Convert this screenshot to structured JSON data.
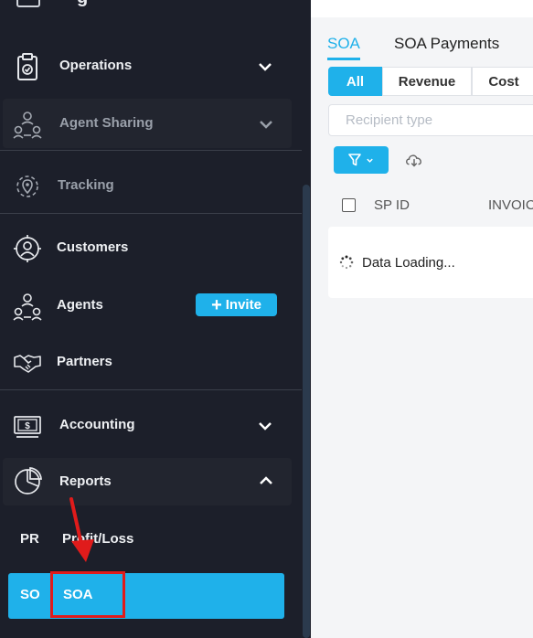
{
  "sidebar": {
    "top_partial_label": "g",
    "items": [
      {
        "key": "operations",
        "label": "Operations",
        "icon": "clipboard-icon",
        "chevron": "down"
      },
      {
        "key": "agent-sharing",
        "label": "Agent Sharing",
        "icon": "agent-sharing-icon",
        "chevron": "down"
      },
      {
        "key": "tracking",
        "label": "Tracking",
        "icon": "location-pin-icon"
      },
      {
        "key": "customers",
        "label": "Customers",
        "icon": "customers-icon"
      },
      {
        "key": "agents",
        "label": "Agents",
        "icon": "agents-icon"
      },
      {
        "key": "partners",
        "label": "Partners",
        "icon": "handshake-icon"
      },
      {
        "key": "accounting",
        "label": "Accounting",
        "icon": "money-icon",
        "chevron": "down"
      },
      {
        "key": "reports",
        "label": "Reports",
        "icon": "pie-chart-icon",
        "chevron": "up"
      }
    ],
    "invite": {
      "plus": "+",
      "label": "Invite"
    },
    "report_subitems": [
      {
        "abbr": "PR",
        "label": "Profit/Loss"
      },
      {
        "abbr": "SO",
        "label": "SOA",
        "active": true
      }
    ]
  },
  "main": {
    "tabs": [
      {
        "label": "SOA",
        "active": true
      },
      {
        "label": "SOA Payments",
        "active": false
      }
    ],
    "segments": [
      {
        "label": "All",
        "active": true
      },
      {
        "label": "Revenue",
        "active": false
      },
      {
        "label": "Cost",
        "active": false
      }
    ],
    "recipient_placeholder": "Recipient type",
    "table_headers": [
      "SP ID",
      "INVOIC"
    ],
    "loading_text": "Data Loading..."
  },
  "colors": {
    "accent": "#1fb1ea",
    "sidebar_bg": "#1c1f2a",
    "highlight": "#e01b1b"
  }
}
